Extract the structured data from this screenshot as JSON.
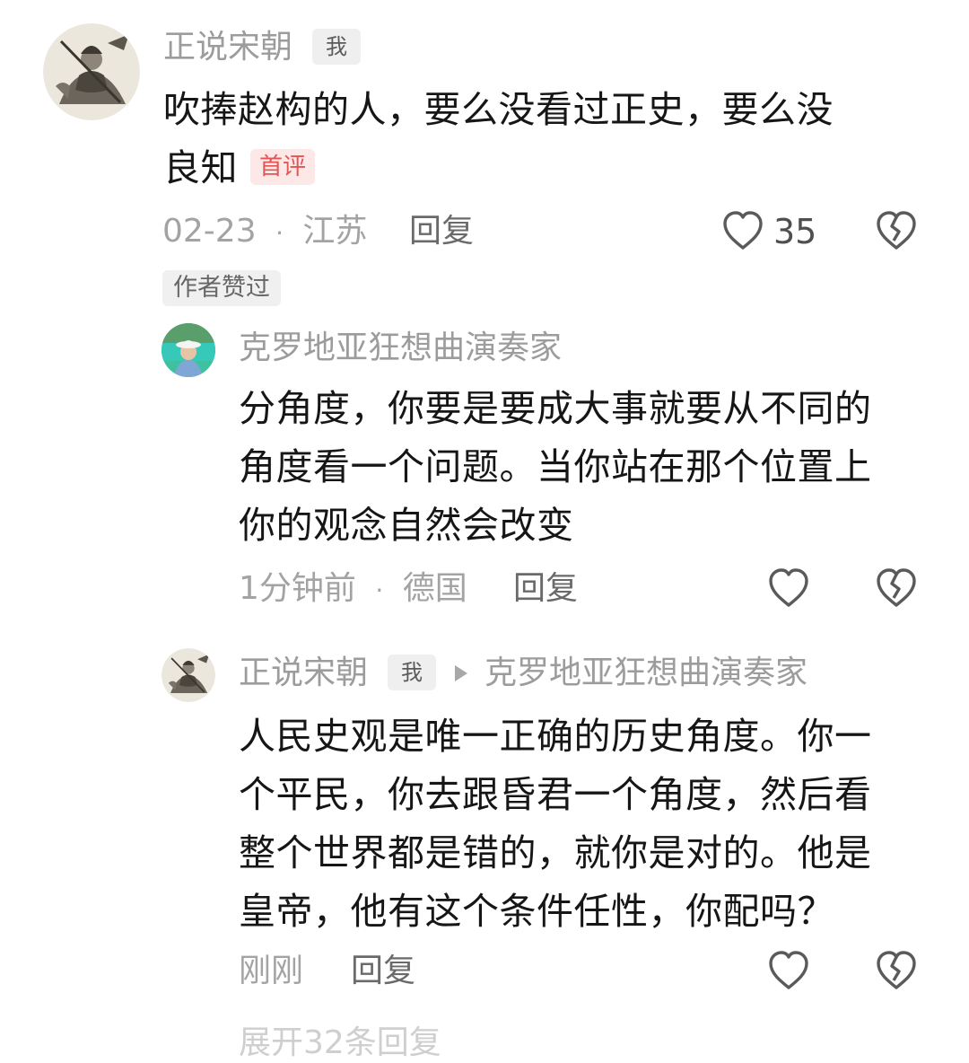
{
  "comments": [
    {
      "user": "正说宋朝",
      "me_tag": "我",
      "text": "吹捧赵构的人，要么没看过正史，要么没良知",
      "text_line1": "吹捧赵构的人，要么没看过正史，要么没",
      "text_line2": "良知",
      "badge": "首评",
      "date": "02-23",
      "location": "江苏",
      "reply_label": "回复",
      "likes": "35",
      "author_liked": "作者赞过",
      "avatar_icon": "warrior-avatar"
    }
  ],
  "replies": [
    {
      "user": "克罗地亚狂想曲演奏家",
      "text_lines": [
        "分角度，你要是要成大事就要从不同的",
        "角度看一个问题。当你站在那个位置上",
        "你的观念自然会改变"
      ],
      "time": "1分钟前",
      "location": "德国",
      "reply_label": "回复",
      "avatar_icon": "person-lake-avatar"
    },
    {
      "user": "正说宋朝",
      "me_tag": "我",
      "reply_to": "克罗地亚狂想曲演奏家",
      "text_lines": [
        "人民史观是唯一正确的历史角度。你一",
        "个平民，你去跟昏君一个角度，然后看",
        "整个世界都是错的，就你是对的。他是",
        "皇帝，他有这个条件任性，你配吗？"
      ],
      "time": "刚刚",
      "reply_label": "回复",
      "avatar_icon": "warrior-avatar"
    }
  ],
  "separator": "·",
  "more_replies": "展开32条回复",
  "colors": {
    "name": "#9c9c9c",
    "body": "#161616",
    "badge_bg": "#fde8e8",
    "badge_text": "#e35454"
  }
}
